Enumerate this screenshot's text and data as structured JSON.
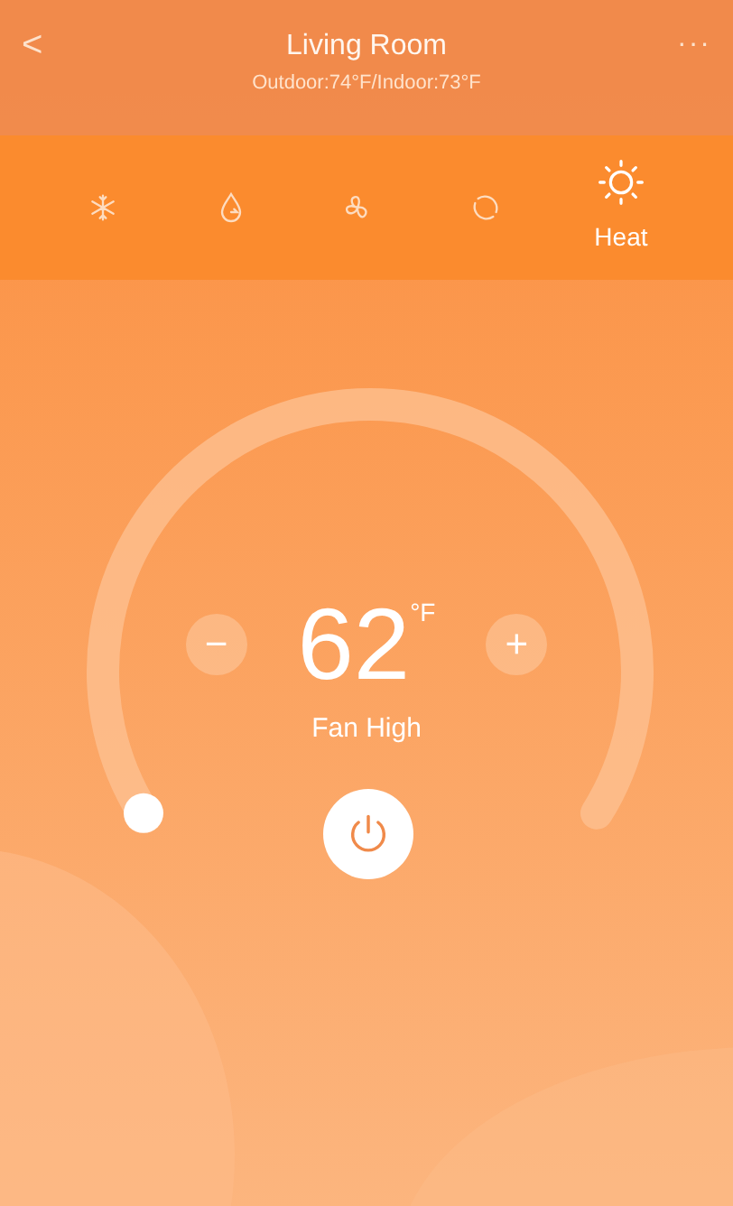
{
  "header": {
    "back": "<",
    "title": "Living Room",
    "subtitle": "Outdoor:74°F/Indoor:73°F",
    "more": "···"
  },
  "modes": [
    {
      "kind": "cool",
      "selected": false
    },
    {
      "kind": "dry",
      "selected": false
    },
    {
      "kind": "fan",
      "selected": false
    },
    {
      "kind": "auto",
      "selected": false
    },
    {
      "kind": "heat",
      "label": "Heat",
      "selected": true
    }
  ],
  "thermostat": {
    "temperature": "62",
    "unit": "°F",
    "minus": "−",
    "plus": "+",
    "fan": "Fan High",
    "level": 0,
    "power_on": true
  }
}
